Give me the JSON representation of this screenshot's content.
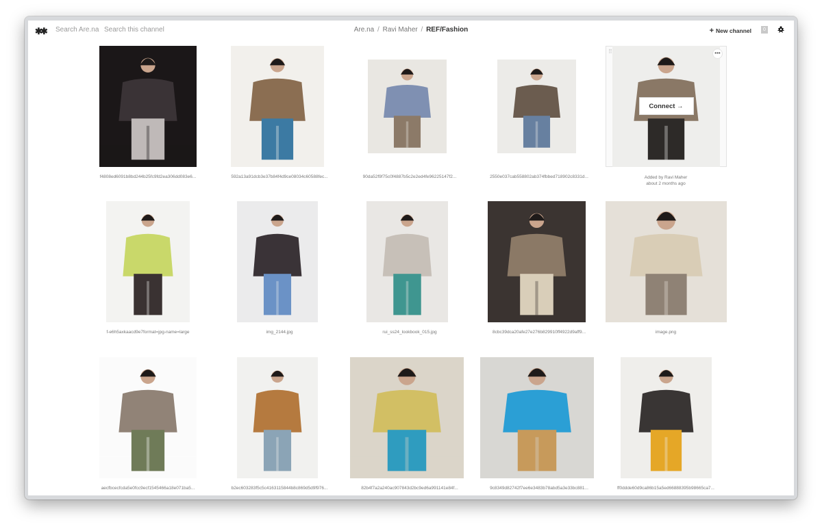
{
  "header": {
    "logo": "✱✱",
    "search_arena_placeholder": "Search Are.na",
    "search_channel_placeholder": "Search this channel",
    "breadcrumb": [
      "Are.na",
      "Ravi Maher",
      "REF/Fashion"
    ],
    "new_channel": "New channel",
    "count": "0"
  },
  "hover": {
    "connect": "Connect →",
    "added_by": "Added by Ravi Maher",
    "added_when": "about 2 months ago",
    "more": "•••",
    "drag": "⠿"
  },
  "blocks": [
    {
      "caption": "f4808ed6091b8bd244b25fc9fd2ea306dd083e6...",
      "palette": [
        "#1b1718",
        "#3a3336",
        "#bfb9b8"
      ]
    },
    {
      "caption": "592a13a91dcb3e37b84f4d9ce08034c60588fec...",
      "palette": [
        "#f2f0ec",
        "#8b6e52",
        "#3c7aa3"
      ]
    },
    {
      "caption": "90da52f9f75c0f4887b5c2e2ed4fe96225147f2...",
      "palette": [
        "#e9e7e2",
        "#7f90b2",
        "#8c7a68"
      ]
    },
    {
      "caption": "2550e037cab558802ab374fbbed718902c8331d...",
      "palette": [
        "#ecebe8",
        "#6b5c4f",
        "#6780a0"
      ]
    },
    {
      "caption": "",
      "palette": [
        "#eeeeec",
        "#8a7866",
        "#2d2a28"
      ]
    },
    {
      "caption": "f-e6h5axkaacd9e7format=jpg-name=large",
      "palette": [
        "#f3f3f1",
        "#c9d86a",
        "#3a3232"
      ]
    },
    {
      "caption": "img_2144.jpg",
      "palette": [
        "#ebebec",
        "#3a3337",
        "#6b92c6"
      ]
    },
    {
      "caption": "rui_ss24_lookbook_015.jpg",
      "palette": [
        "#e9e7e4",
        "#c7c0b8",
        "#3f9690"
      ]
    },
    {
      "caption": "8cbc39dca20afe27e276b829910ff4922d9aff9...",
      "palette": [
        "#3b3431",
        "#8b7966",
        "#d9ceb9"
      ]
    },
    {
      "caption": "image.png",
      "palette": [
        "#e5e0d8",
        "#d9cdb6",
        "#8f8275"
      ]
    },
    {
      "caption": "aecfbcecfcda5e0fcc9ecf1545466a18e071ba5...",
      "palette": [
        "#fbfbfb",
        "#918377",
        "#6f7b58"
      ]
    },
    {
      "caption": "b2ec603283f5c5c4163115844b8c869d5d9f976...",
      "palette": [
        "#f1f1ef",
        "#b57a3f",
        "#8ba4b6"
      ]
    },
    {
      "caption": "82b4f7a2a240ac907843d2bc9ed6a991141e84f...",
      "palette": [
        "#dbd5c9",
        "#d2bf64",
        "#2f9cbf"
      ]
    },
    {
      "caption": "9c8349d82742f7ee6e3483b78abd5a3e33bc881...",
      "palette": [
        "#d8d7d3",
        "#2b9fd5",
        "#c79a5b"
      ]
    },
    {
      "caption": "ff0ddde60d9ca86b15a5ed66888395b98665ca7...",
      "palette": [
        "#efeeeb",
        "#393534",
        "#e5a727"
      ]
    }
  ]
}
